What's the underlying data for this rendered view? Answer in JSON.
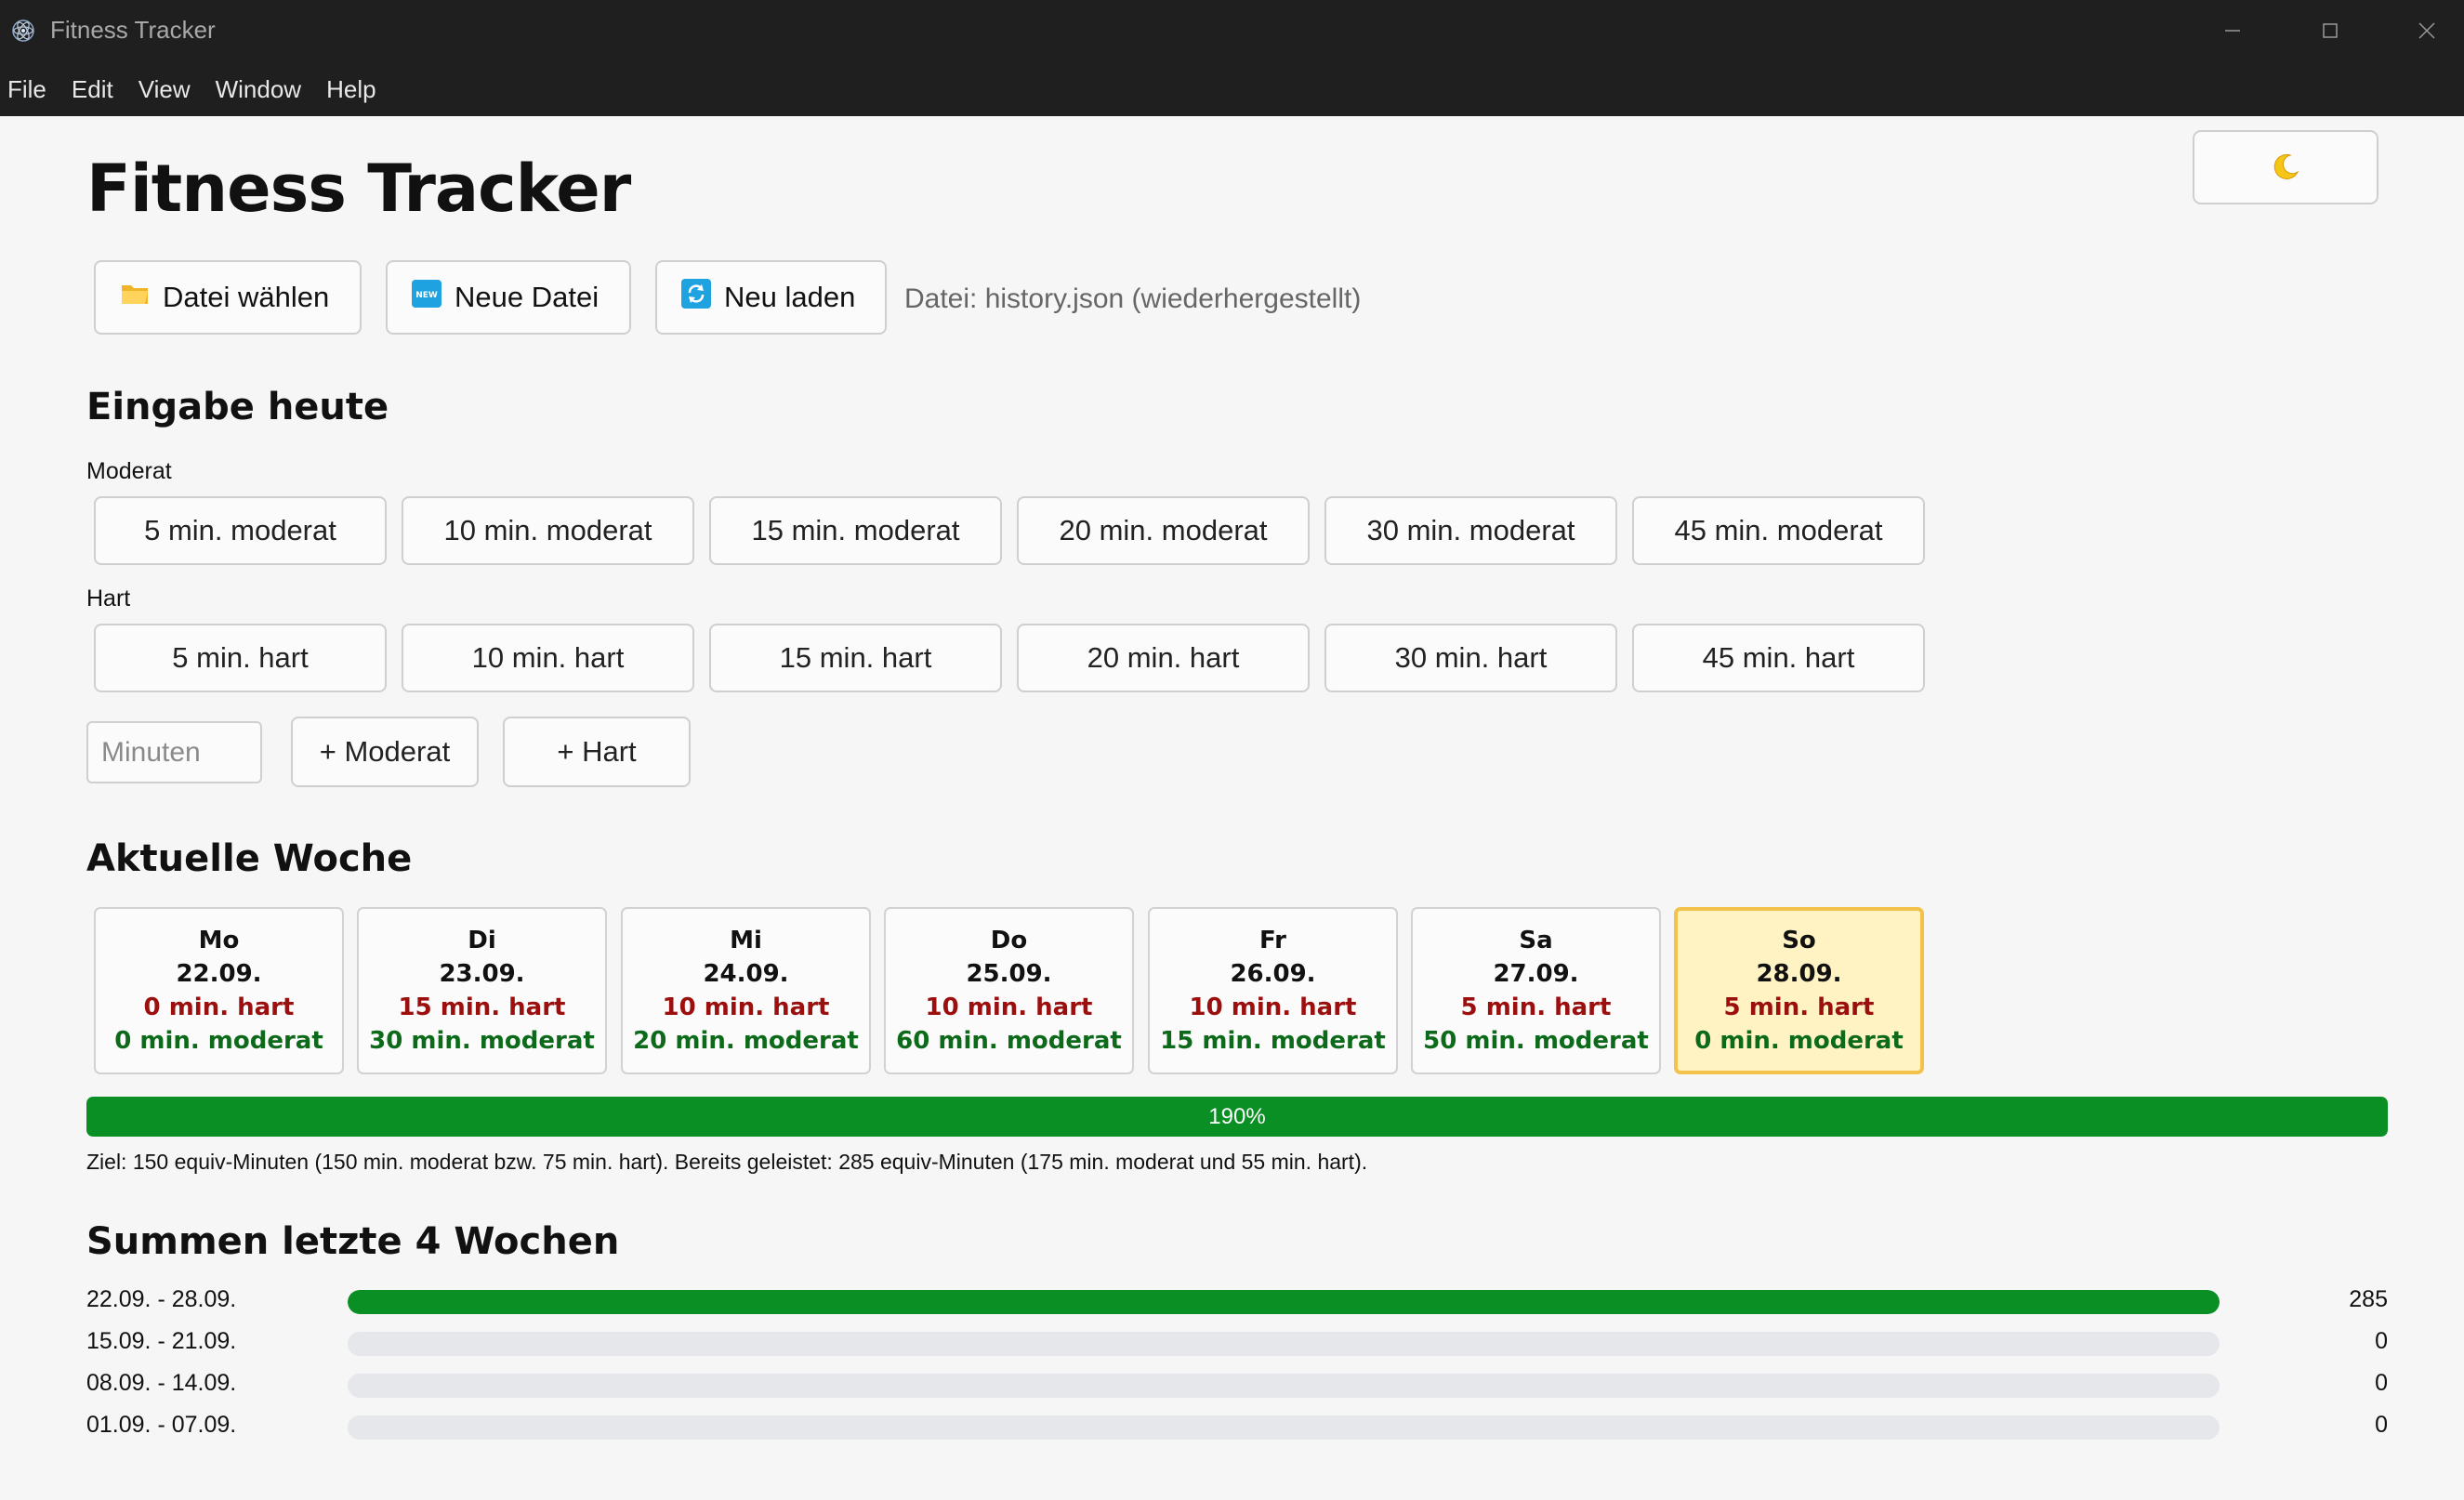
{
  "window": {
    "title": "Fitness Tracker",
    "icon": "electron-atom-icon"
  },
  "menu": [
    "File",
    "Edit",
    "View",
    "Window",
    "Help"
  ],
  "header": {
    "title": "Fitness Tracker",
    "theme_toggle_icon": "moon-icon"
  },
  "file_bar": {
    "choose_label": "Datei wählen",
    "new_label": "Neue Datei",
    "reload_label": "Neu laden",
    "status": "Datei: history.json (wiederhergestellt)"
  },
  "entry": {
    "heading": "Eingabe heute",
    "moderat_label": "Moderat",
    "hart_label": "Hart",
    "moderat_presets": [
      "5 min. moderat",
      "10 min. moderat",
      "15 min. moderat",
      "20 min. moderat",
      "30 min. moderat",
      "45 min. moderat"
    ],
    "hart_presets": [
      "5 min. hart",
      "10 min. hart",
      "15 min. hart",
      "20 min. hart",
      "30 min. hart",
      "45 min. hart"
    ],
    "minutes_placeholder": "Minuten",
    "minutes_value": "",
    "add_moderat_label": "+ Moderat",
    "add_hart_label": "+ Hart"
  },
  "week": {
    "heading": "Aktuelle Woche",
    "days": [
      {
        "name": "Mo",
        "date": "22.09.",
        "hart": "0 min. hart",
        "moderat": "0 min. moderat",
        "today": false
      },
      {
        "name": "Di",
        "date": "23.09.",
        "hart": "15 min. hart",
        "moderat": "30 min. moderat",
        "today": false
      },
      {
        "name": "Mi",
        "date": "24.09.",
        "hart": "10 min. hart",
        "moderat": "20 min. moderat",
        "today": false
      },
      {
        "name": "Do",
        "date": "25.09.",
        "hart": "10 min. hart",
        "moderat": "60 min. moderat",
        "today": false
      },
      {
        "name": "Fr",
        "date": "26.09.",
        "hart": "10 min. hart",
        "moderat": "15 min. moderat",
        "today": false
      },
      {
        "name": "Sa",
        "date": "27.09.",
        "hart": "5 min. hart",
        "moderat": "50 min. moderat",
        "today": false
      },
      {
        "name": "So",
        "date": "28.09.",
        "hart": "5 min. hart",
        "moderat": "0 min. moderat",
        "today": true
      }
    ],
    "progress_text": "190%",
    "progress_fraction": 1.0,
    "goal_text": "Ziel: 150 equiv-Minuten (150 min. moderat bzw. 75 min. hart). Bereits geleistet: 285 equiv-Minuten (175 min. moderat und 55 min. hart)."
  },
  "summary": {
    "heading": "Summen letzte 4 Wochen",
    "rows": [
      {
        "label": "22.09. - 28.09.",
        "value": "285",
        "fraction": 1.0
      },
      {
        "label": "15.09. - 21.09.",
        "value": "0",
        "fraction": 0
      },
      {
        "label": "08.09. - 14.09.",
        "value": "0",
        "fraction": 0
      },
      {
        "label": "01.09. - 07.09.",
        "value": "0",
        "fraction": 0
      }
    ]
  },
  "colors": {
    "accent_green": "#0a8f24",
    "hart_red": "#9b0f0f",
    "moderat_green": "#0d6a1b",
    "today_bg": "#fff3c4",
    "today_border": "#f2c24b",
    "titlebar_bg": "#1f1f1f"
  }
}
